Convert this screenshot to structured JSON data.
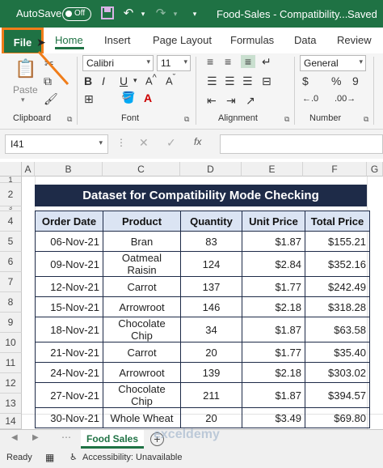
{
  "titlebar": {
    "autosave_label": "AutoSave",
    "autosave_state": "Off",
    "doc_title": "Food-Sales  -  Compatibility...",
    "save_status": "Saved"
  },
  "tabs": [
    {
      "label": "File"
    },
    {
      "label": "Home"
    },
    {
      "label": "Insert"
    },
    {
      "label": "Page Layout"
    },
    {
      "label": "Formulas"
    },
    {
      "label": "Data"
    },
    {
      "label": "Review"
    }
  ],
  "ribbon": {
    "clipboard": {
      "paste_label": "Paste",
      "group_label": "Clipboard"
    },
    "font": {
      "font_name": "Calibri",
      "font_size": "11",
      "group_label": "Font"
    },
    "alignment": {
      "group_label": "Alignment"
    },
    "number": {
      "format": "General",
      "group_label": "Number"
    }
  },
  "formula_bar": {
    "name_box": "I41",
    "fx_label": "fx"
  },
  "grid": {
    "columns": [
      "A",
      "B",
      "C",
      "D",
      "E",
      "F",
      "G"
    ],
    "rows": [
      "1",
      "2",
      "3",
      "4",
      "5",
      "6",
      "7",
      "8",
      "9",
      "10",
      "11",
      "12",
      "13",
      "14"
    ]
  },
  "table": {
    "title": "Dataset for Compatibility Mode Checking",
    "headers": [
      "Order Date",
      "Product",
      "Quantity",
      "Unit Price",
      "Total Price"
    ],
    "rows": [
      [
        "06-Nov-21",
        "Bran",
        "83",
        "$1.87",
        "$155.21"
      ],
      [
        "09-Nov-21",
        "Oatmeal Raisin",
        "124",
        "$2.84",
        "$352.16"
      ],
      [
        "12-Nov-21",
        "Carrot",
        "137",
        "$1.77",
        "$242.49"
      ],
      [
        "15-Nov-21",
        "Arrowroot",
        "146",
        "$2.18",
        "$318.28"
      ],
      [
        "18-Nov-21",
        "Chocolate Chip",
        "34",
        "$1.87",
        "$63.58"
      ],
      [
        "21-Nov-21",
        "Carrot",
        "20",
        "$1.77",
        "$35.40"
      ],
      [
        "24-Nov-21",
        "Arrowroot",
        "139",
        "$2.18",
        "$303.02"
      ],
      [
        "27-Nov-21",
        "Chocolate Chip",
        "211",
        "$1.87",
        "$394.57"
      ],
      [
        "30-Nov-21",
        "Whole Wheat",
        "20",
        "$3.49",
        "$69.80"
      ]
    ]
  },
  "sheets": {
    "active": "Food Sales"
  },
  "statusbar": {
    "ready": "Ready",
    "accessibility": "Accessibility: Unavailable"
  },
  "watermark": "exceldemy",
  "colors": {
    "accent": "#1f7244",
    "table_header": "#1e2b48",
    "highlight": "#f07d1a"
  }
}
